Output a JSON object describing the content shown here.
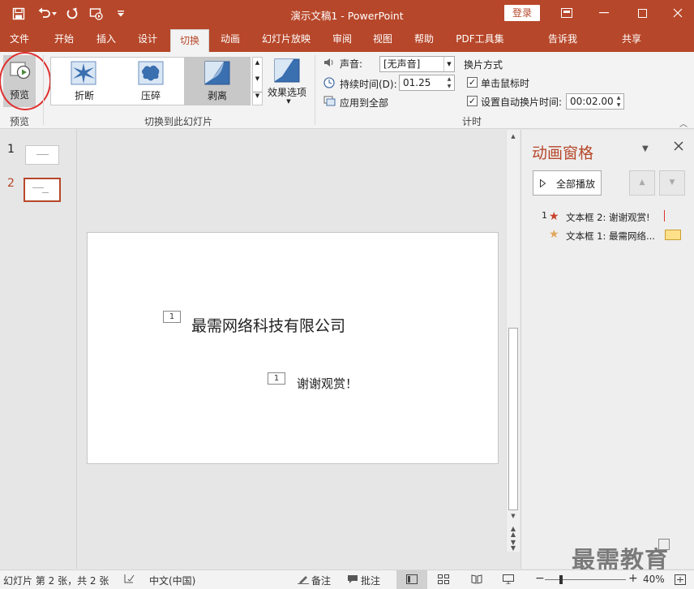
{
  "title_bar": {
    "doc_title": "演示文稿1 - PowerPoint",
    "login_label": "登录",
    "quick_access": [
      "save-icon",
      "undo-icon",
      "redo-icon",
      "start-from-beginning-icon",
      "customize-icon"
    ],
    "accent_color": "#b7472a"
  },
  "tabs": [
    {
      "label": "文件"
    },
    {
      "label": "开始"
    },
    {
      "label": "插入"
    },
    {
      "label": "设计"
    },
    {
      "label": "切换",
      "active": true
    },
    {
      "label": "动画"
    },
    {
      "label": "幻灯片放映"
    },
    {
      "label": "审阅"
    },
    {
      "label": "视图"
    },
    {
      "label": "帮助"
    },
    {
      "label": "PDF工具集"
    },
    {
      "label": "告诉我"
    },
    {
      "label": "共享"
    }
  ],
  "ribbon": {
    "preview": {
      "button_label": "预览",
      "group_label": "预览"
    },
    "transitions": {
      "items": [
        {
          "label": "折断"
        },
        {
          "label": "压碎"
        },
        {
          "label": "剥离",
          "selected": true
        }
      ],
      "effect_options_label": "效果选项",
      "group_label": "切换到此幻灯片"
    },
    "timing": {
      "sound_label": "声音:",
      "sound_value": "[无声音]",
      "duration_label": "持续时间(D):",
      "duration_value": "01.25",
      "apply_all_label": "应用到全部",
      "advance_title": "换片方式",
      "on_click_label": "单击鼠标时",
      "on_click_checked": true,
      "after_label": "设置自动换片时间:",
      "after_checked": true,
      "after_value": "00:02.00",
      "group_label": "计时"
    }
  },
  "slides_panel": {
    "slides": [
      {
        "number": "1"
      },
      {
        "number": "2",
        "selected": true
      }
    ]
  },
  "slide": {
    "text1": "最需网络科技有限公司",
    "tag1": "1",
    "text2": "谢谢观赏！",
    "tag2": "1"
  },
  "animation_pane": {
    "title": "动画窗格",
    "play_all_label": "全部播放",
    "items": [
      {
        "index": "1",
        "label": "文本框 2: 谢谢观赏!",
        "star_color": "#c8402a"
      },
      {
        "index": "",
        "label": "文本框 1: 最需网络...",
        "star_color": "#e0a85a"
      }
    ]
  },
  "status_bar": {
    "slide_info": "幻灯片 第 2 张，共 2 张",
    "language": "中文(中国)",
    "notes_label": "备注",
    "comments_label": "批注",
    "zoom_label": "40%",
    "zoom_minus": "−",
    "zoom_plus": "+",
    "zoom_value": 40
  },
  "watermark": "最需教育"
}
